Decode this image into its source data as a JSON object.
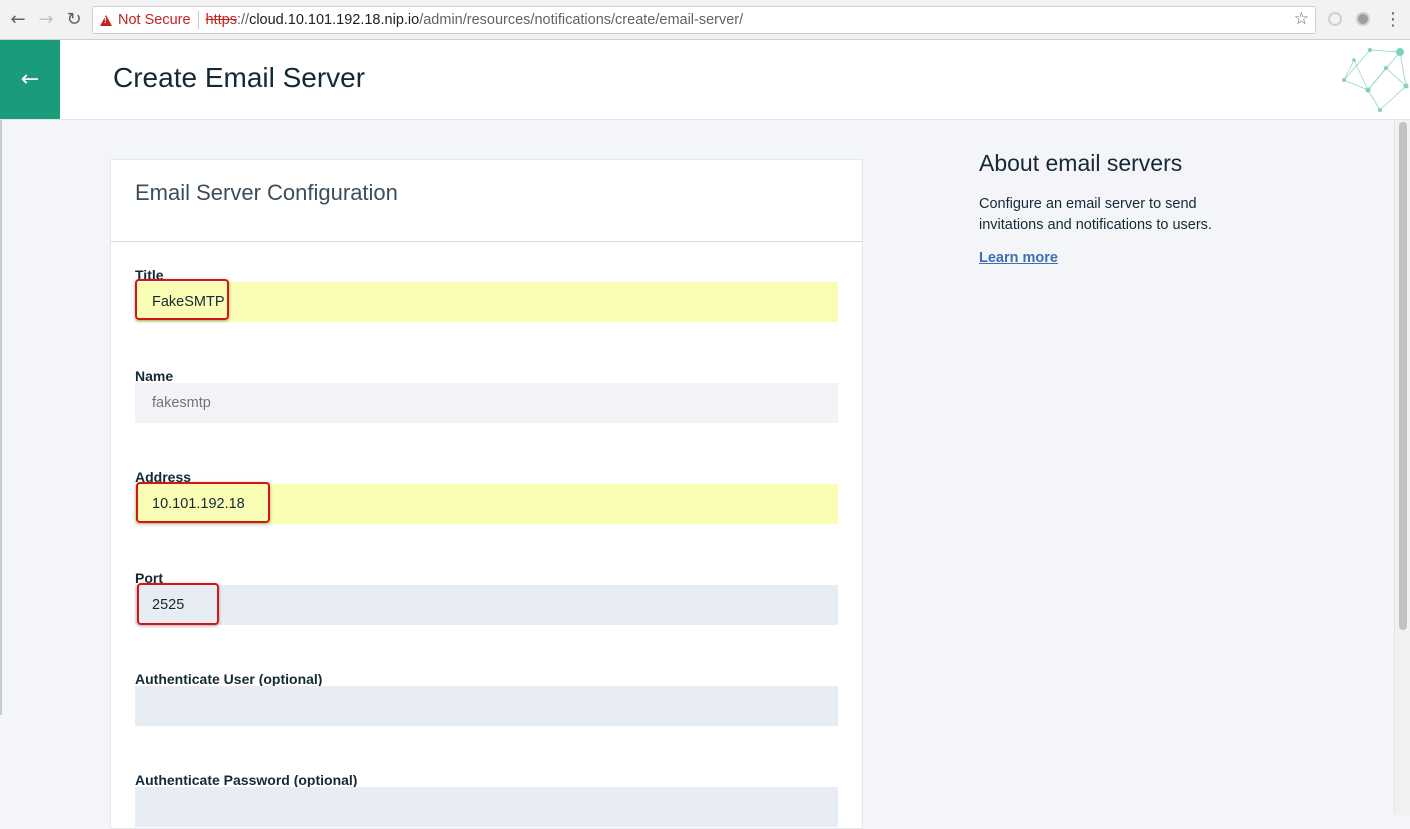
{
  "browser": {
    "security_label": "Not Secure",
    "url_scheme": "https",
    "url_colon": "://",
    "url_host": "cloud.10.101.192.18.nip.io",
    "url_path": "/admin/resources/notifications/create/email-server/"
  },
  "header": {
    "title": "Create Email Server",
    "accent_color": "#1a9b7c"
  },
  "form": {
    "title": "Email Server Configuration",
    "fields": [
      {
        "label": "Title",
        "value": "FakeSMTP"
      },
      {
        "label": "Name",
        "placeholder": "fakesmtp"
      },
      {
        "label": "Address",
        "value": "10.101.192.18"
      },
      {
        "label": "Port",
        "value": "2525"
      },
      {
        "label": "Authenticate User (optional)",
        "value": ""
      },
      {
        "label": "Authenticate Password (optional)",
        "value": ""
      }
    ]
  },
  "side_panel": {
    "title": "About email servers",
    "description": "Configure an email server to send invitations and notifications to users.",
    "link_label": "Learn more",
    "link_color": "#3d70b2"
  }
}
